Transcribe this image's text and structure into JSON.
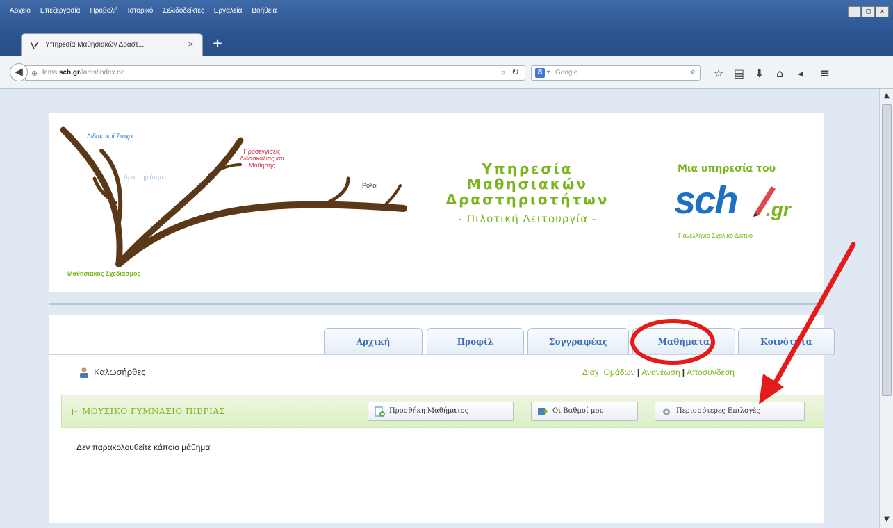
{
  "browser": {
    "menu": [
      "Αρχείο",
      "Επεξεργασία",
      "Προβολή",
      "Ιστορικό",
      "Σελιδοδείκτες",
      "Εργαλεία",
      "Βοήθεια"
    ],
    "window_controls": [
      "_",
      "□",
      "×"
    ],
    "tab_title": "Υπηρεσία Μαθησιακών Δραστ...",
    "tab_close": "×",
    "new_tab": "+",
    "url_prefix": "lams.",
    "url_domain": "sch.gr",
    "url_path": "/lams/index.do",
    "search_placeholder": "Google"
  },
  "header": {
    "tree_labels": {
      "goals": "Διδακτικοί Στόχοι",
      "activities": "Δραστηριότητες",
      "approaches": "Προσεγγίσεις\nΔιδασκαλίας και\nΜάθησης",
      "roles": "Ρόλοι",
      "design": "Μαθησιακός Σχεδιασμός"
    },
    "brand_lines": [
      "Υπηρεσία",
      "Μαθησιακών",
      "Δραστηριοτήτων"
    ],
    "brand_sub": "- Πιλοτική Λειτουργία -",
    "sch_title": "Μια υπηρεσία του",
    "sch_logo": "sch",
    "sch_gr": ".gr",
    "sch_sub": "Πανελλήνιο Σχολικό Δίκτυο"
  },
  "nav": {
    "tabs": [
      "Αρχική",
      "Προφίλ",
      "Συγγραφέας",
      "Μαθήματα",
      "Κοινότητα"
    ]
  },
  "user": {
    "welcome": "Καλωσήρθες",
    "links": [
      "Διαχ. Ομάδων",
      "Ανανέωση",
      "Αποσύνδεση"
    ]
  },
  "school": {
    "name": "ΜΟΥΣΙΚΟ ΓΥΜΝΑΣΙΟ ΠΙΕΡΙΑΣ",
    "collapse": "−",
    "buttons": {
      "add_course": "Προσθήκη Μαθήματος",
      "my_grades": "Οι Βαθμοί μου",
      "more_options": "Περισσότερες Επιλογές"
    }
  },
  "content": {
    "no_course": "Δεν παρακολουθείτε κάποιο μάθημα"
  },
  "colors": {
    "accent_green": "#7ab51d",
    "tab_blue": "#3a6fb0",
    "annotation_red": "#e31b1b"
  }
}
